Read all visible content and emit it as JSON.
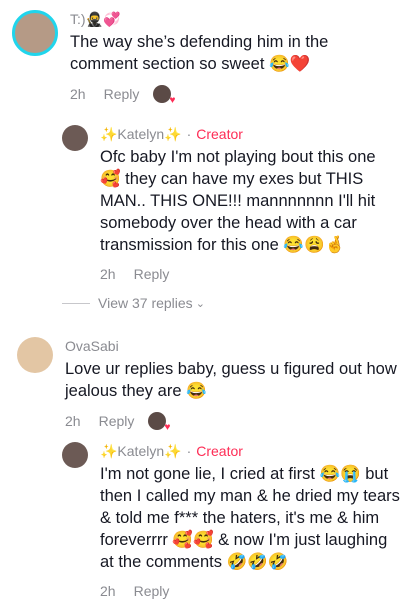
{
  "comments": [
    {
      "username": "T:)🥷💞",
      "text": "The way she’s defending him in the comment section so sweet 😂❤️",
      "time": "2h",
      "reply": "Reply"
    },
    {
      "username": "✨Katelyn✨",
      "creator_sep": "·",
      "creator": "Creator",
      "text": "Ofc baby I'm not playing bout this one 🥰 they can have my exes but THIS MAN.. THIS ONE!!! mannnnnnn I'll hit somebody over the head with a car transmission for this one 😂😩🤞",
      "time": "2h",
      "reply": "Reply"
    },
    {
      "username": "OvaSabi",
      "text": "Love ur replies baby, guess u figured out how jealous they are 😂",
      "time": "2h",
      "reply": "Reply"
    },
    {
      "username": "✨Katelyn✨",
      "creator_sep": "·",
      "creator": "Creator",
      "text": "I'm not gone lie, I cried at first 😂😭 but then I called my man & he dried my tears & told me f*** the haters, it's me & him foreverrrr 🥰🥰 & now I'm just laughing at the comments 🤣🤣🤣",
      "time": "2h",
      "reply": "Reply"
    }
  ],
  "view_replies": "View 37 replies",
  "colors": {
    "creator": "#fe2c55",
    "muted": "#8a8b91",
    "text": "#161823"
  }
}
